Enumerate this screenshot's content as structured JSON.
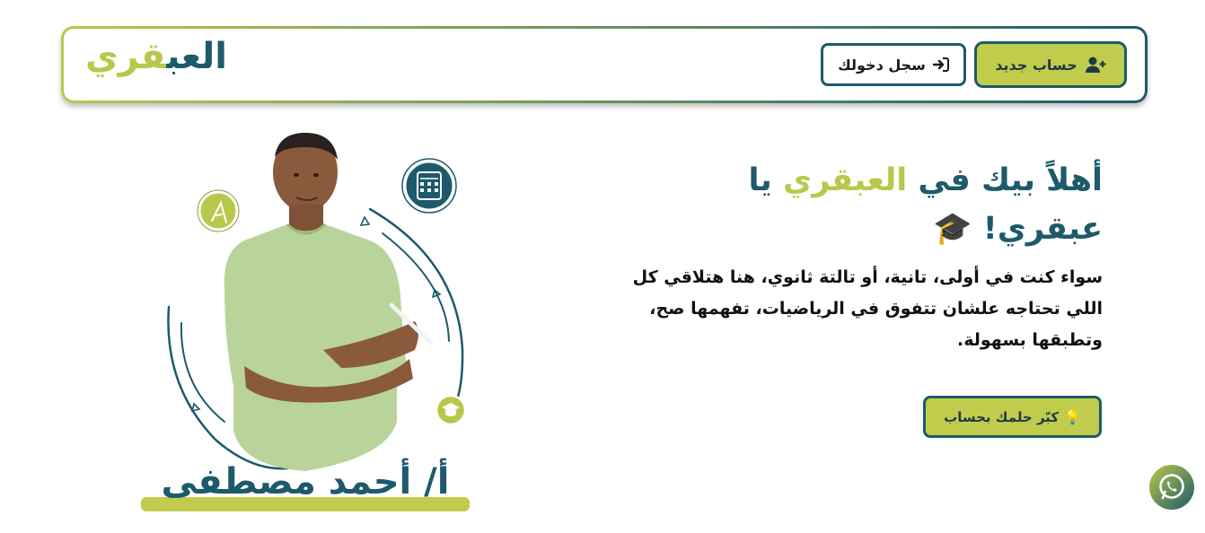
{
  "header": {
    "logo_part1": "العب",
    "logo_part2": "قري",
    "login_label": "سجل دخولك",
    "register_label": "حساب جديد"
  },
  "hero": {
    "title_part1": "أهلاً بيك في ",
    "title_highlight": "العبقري",
    "title_part2": " يا عبقري! 🎓",
    "description": "سواء كنت في أولى، تانية، أو تالتة ثانوي، هنا هتلاقي كل اللي تحتاجه علشان تتفوق في الرياضيات، تفهمها صح، وتطبقها بسهولة.",
    "cta_label": "كبّر حلمك بحساب",
    "cta_emoji": "💡"
  },
  "teacher": {
    "name": "أ/ أحمد مصطفى"
  },
  "colors": {
    "primary": "#1d5a6b",
    "accent": "#c2cc4c"
  },
  "icons": {
    "login": "sign-in-icon",
    "register": "user-plus-icon",
    "whatsapp": "whatsapp-icon",
    "calculator": "calculator-icon",
    "compass": "compass-icon",
    "graduation": "graduation-cap-icon"
  }
}
